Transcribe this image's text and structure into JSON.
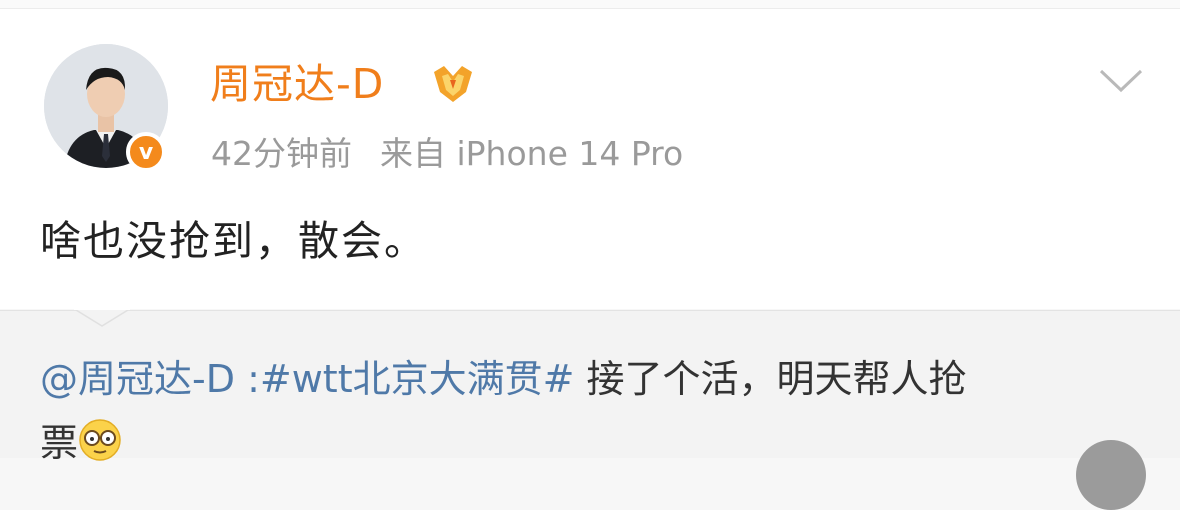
{
  "post": {
    "author": "周冠达-D",
    "time": "42分钟前",
    "source": "来自 iPhone 14 Pro",
    "text": "啥也没抢到，散会。",
    "verified_badge": "v"
  },
  "repost": {
    "mention": "@周冠达-D",
    "separator": " :",
    "hashtag": "#wtt北京大满贯#",
    "text_line1": " 接了个活，明天帮人抢",
    "text_line2": "票"
  },
  "icons": {
    "avatar": "avatar-photo",
    "verified": "verified-v-icon",
    "member": "member-crown-icon",
    "more": "chevron-down-icon",
    "emoji": "glasses-emoji-icon"
  },
  "colors": {
    "author": "#f07e1b",
    "link": "#4f79a8",
    "verified": "#f48a1c"
  }
}
